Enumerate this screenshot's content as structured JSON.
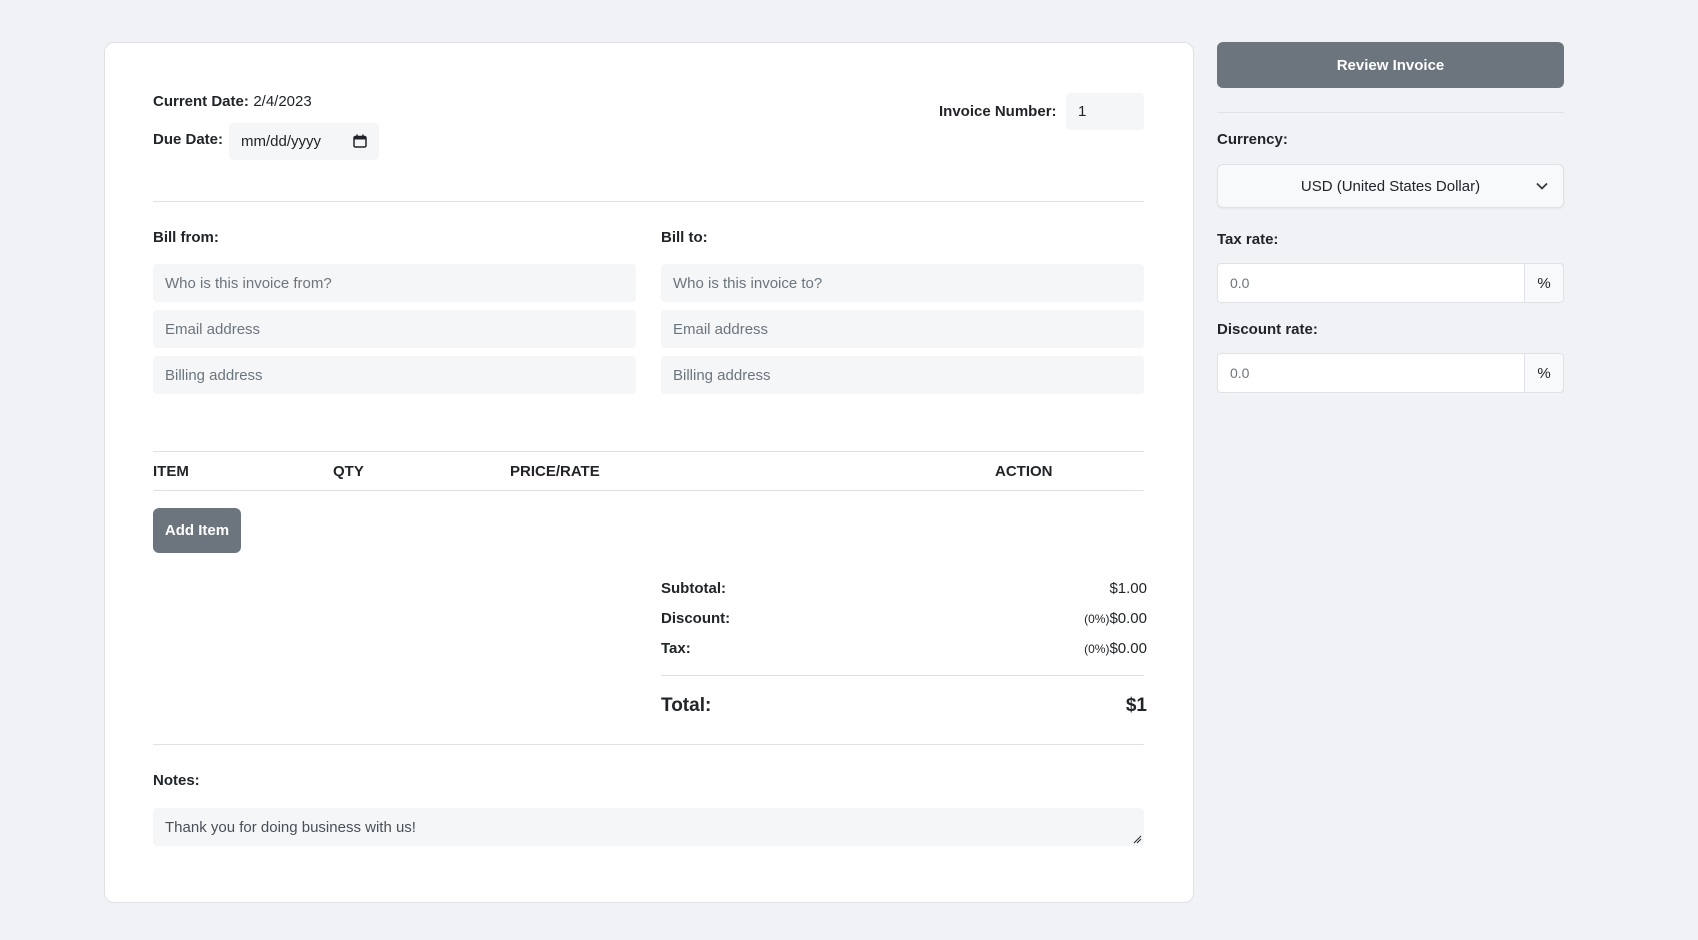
{
  "invoice": {
    "current_date_label": "Current Date:",
    "current_date_value": "2/4/2023",
    "due_date_label": "Due Date:",
    "due_date_placeholder": "mm/dd/yyyy",
    "invoice_number_label": "Invoice Number:",
    "invoice_number_value": "1"
  },
  "bill_from": {
    "label": "Bill from:",
    "name_placeholder": "Who is this invoice from?",
    "email_placeholder": "Email address",
    "address_placeholder": "Billing address"
  },
  "bill_to": {
    "label": "Bill to:",
    "name_placeholder": "Who is this invoice to?",
    "email_placeholder": "Email address",
    "address_placeholder": "Billing address"
  },
  "items_table": {
    "headers": [
      "ITEM",
      "QTY",
      "PRICE/RATE",
      "ACTION"
    ],
    "add_item_label": "Add Item"
  },
  "totals": {
    "subtotal_label": "Subtotal:",
    "subtotal_value": "$1.00",
    "discount_label": "Discount:",
    "discount_pct": "(0%)",
    "discount_value": "$0.00",
    "tax_label": "Tax:",
    "tax_pct": "(0%)",
    "tax_value": "$0.00",
    "total_label": "Total:",
    "total_value": "$1"
  },
  "notes": {
    "label": "Notes:",
    "value": "Thank you for doing business with us!"
  },
  "sidebar": {
    "review_label": "Review Invoice",
    "currency_label": "Currency:",
    "currency_value": "USD (United States Dollar)",
    "tax_rate_label": "Tax rate:",
    "tax_rate_placeholder": "0.0",
    "discount_rate_label": "Discount rate:",
    "discount_rate_placeholder": "0.0",
    "percent_symbol": "%"
  },
  "colors": {
    "button_bg": "#6c757d",
    "page_bg": "#f1f2f5",
    "input_bg": "#f5f6f7"
  }
}
